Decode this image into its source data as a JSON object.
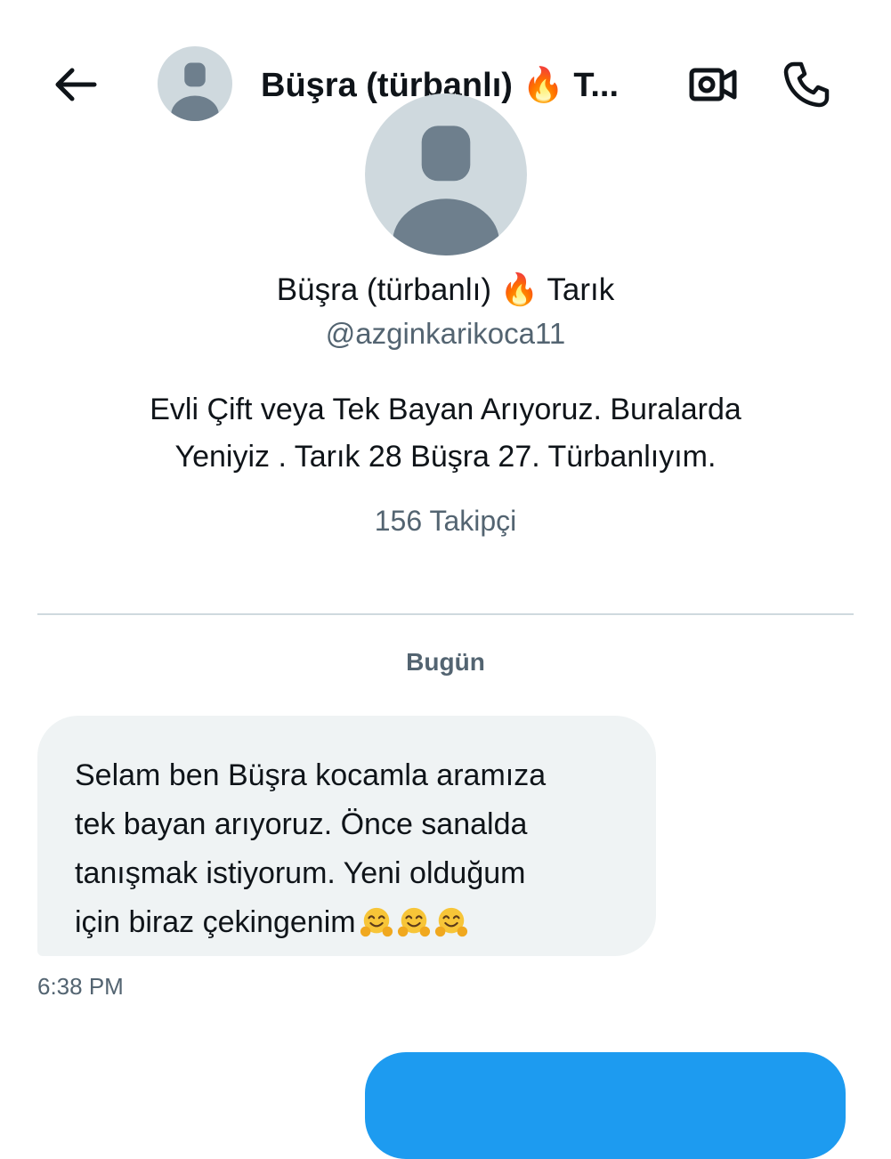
{
  "header": {
    "title": "Büşra (türbanlı) 🔥 T...",
    "back_icon": "arrow-left-icon",
    "video_icon": "video-camera-icon",
    "call_icon": "phone-icon"
  },
  "profile": {
    "name": "Büşra (türbanlı) 🔥 Tarık",
    "handle": "@azginkarikoca11",
    "bio_line1": "Evli Çift veya Tek Bayan Arıyoruz. Buralarda",
    "bio_line2": "Yeniyiz . Tarık 28 Büşra 27. Türbanlıyım.",
    "followers": "156 Takipçi"
  },
  "conversation": {
    "date_label": "Bugün",
    "messages": [
      {
        "lines": [
          "Selam ben Büşra kocamla aramıza",
          "tek bayan arıyoruz. Önce sanalda",
          "tanışmak istiyorum. Yeni olduğum",
          "için biraz çekingenim"
        ],
        "emojis": [
          "hugging-face-emoji",
          "hugging-face-emoji",
          "hugging-face-emoji"
        ],
        "time": "6:38 PM"
      }
    ]
  },
  "colors": {
    "text": "#0f1419",
    "secondary": "#536471",
    "bubble_incoming": "#eff3f4",
    "bubble_outgoing": "#1d9bf0",
    "avatar_bg": "#cfd9de",
    "avatar_fg": "#6e7f8d",
    "divider": "#cfd9de"
  }
}
